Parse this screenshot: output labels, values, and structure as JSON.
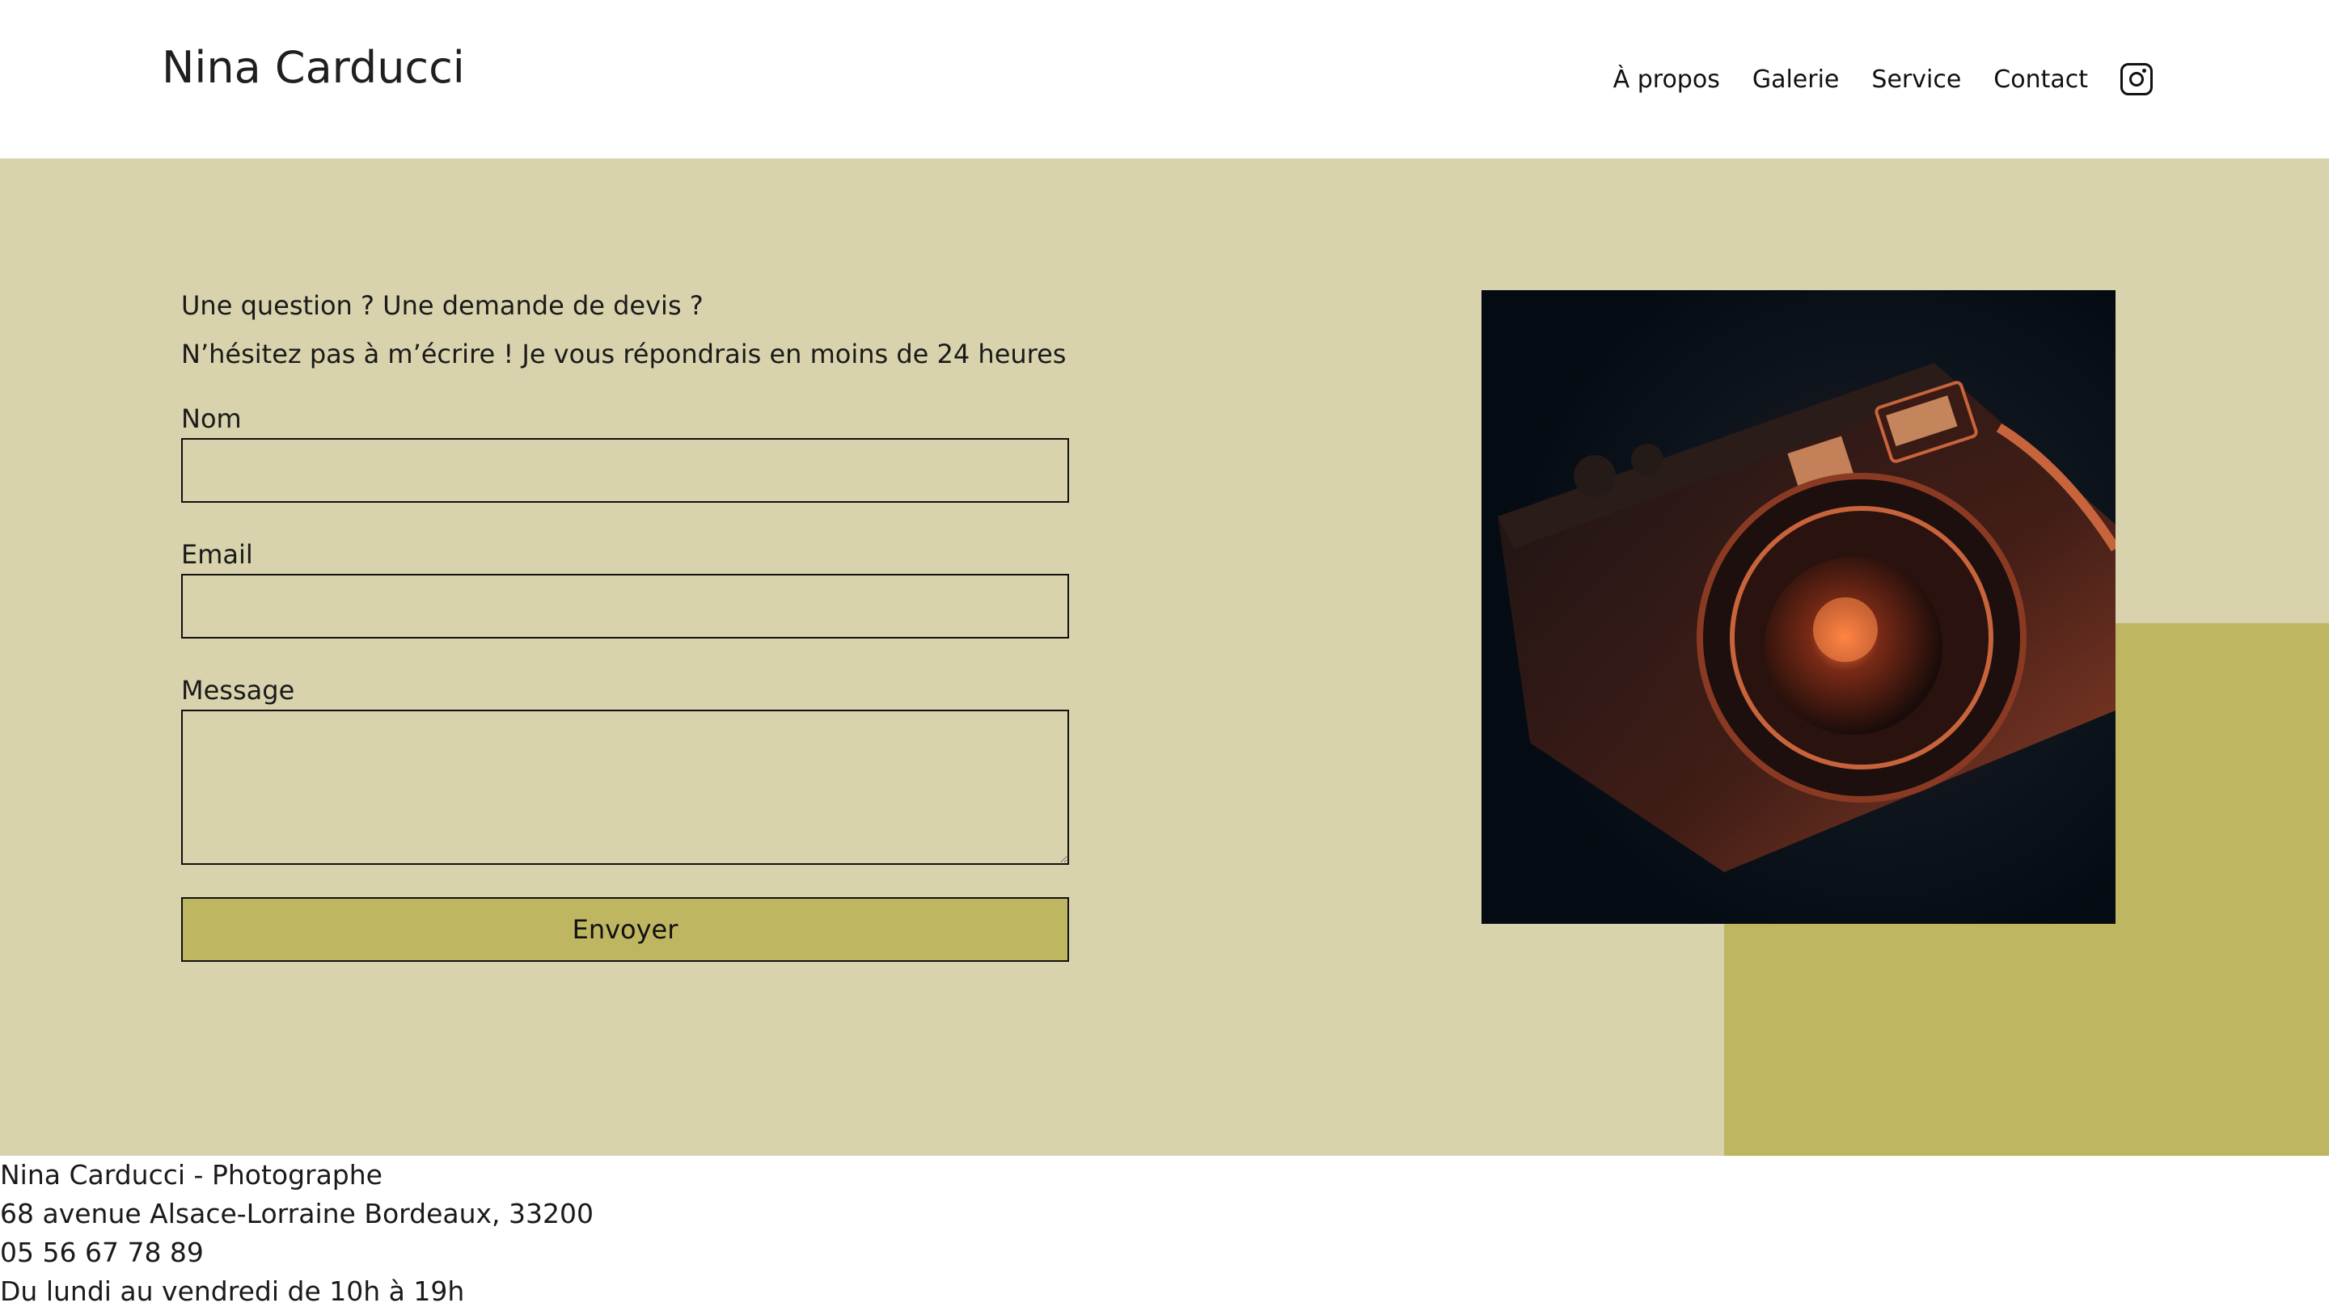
{
  "header": {
    "brand": "Nina Carducci",
    "nav": [
      {
        "label": "À propos"
      },
      {
        "label": "Galerie"
      },
      {
        "label": "Service"
      },
      {
        "label": "Contact"
      }
    ],
    "social_icon": "instagram-icon"
  },
  "contact": {
    "intro_line1": "Une question ? Une demande de devis ?",
    "intro_line2": "N’hésitez pas à m’écrire ! Je vous répondrais en moins de 24 heures",
    "name_label": "Nom",
    "name_value": "",
    "email_label": "Email",
    "email_value": "",
    "message_label": "Message",
    "message_value": "",
    "submit_label": "Envoyer"
  },
  "footer": {
    "line1": "Nina Carducci - Photographe",
    "line2": "68 avenue Alsace-Lorraine Bordeaux, 33200",
    "line3": "05 56 67 78 89",
    "line4": "Du lundi au vendredi de 10h à 19h"
  },
  "colors": {
    "hero_background": "#d8d3ac",
    "accent": "#bfb662",
    "text": "#1a1a1a"
  }
}
